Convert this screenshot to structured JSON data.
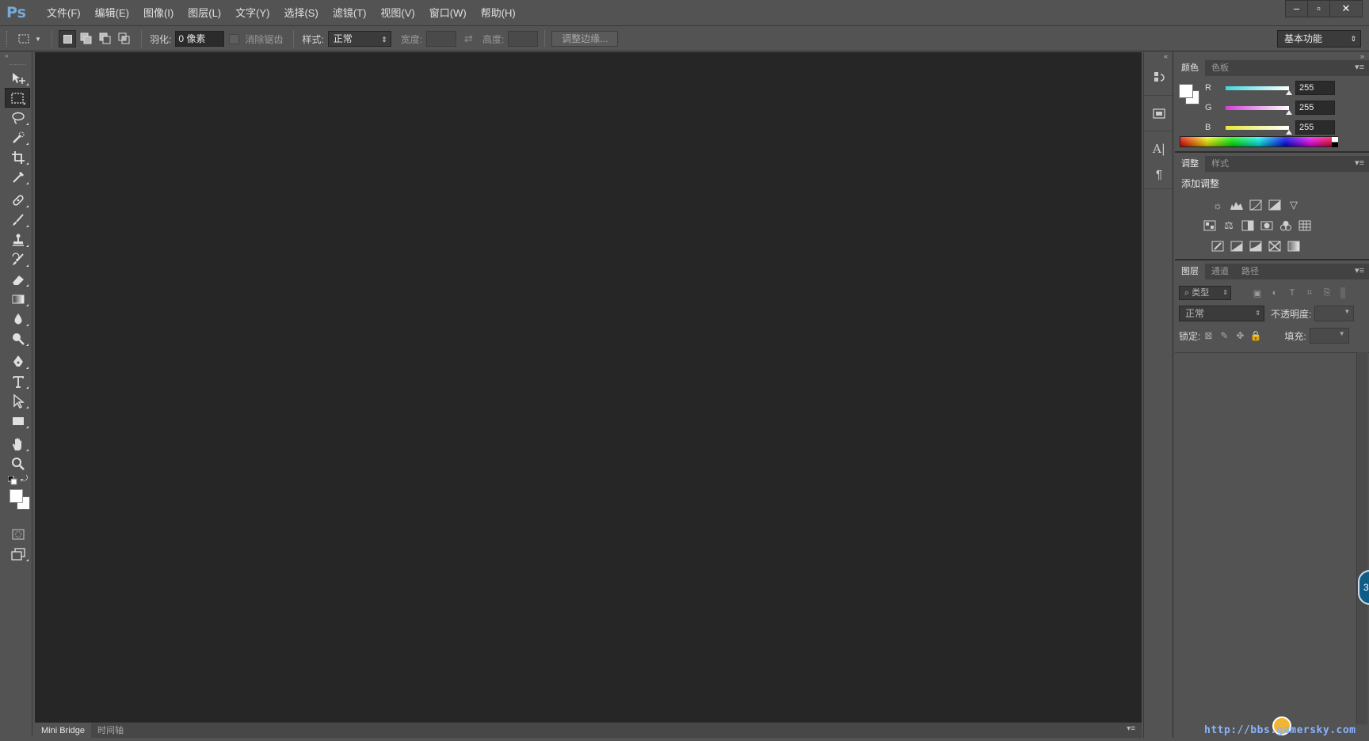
{
  "app": {
    "logo": "Ps"
  },
  "menu": [
    "文件(F)",
    "编辑(E)",
    "图像(I)",
    "图层(L)",
    "文字(Y)",
    "选择(S)",
    "滤镜(T)",
    "视图(V)",
    "窗口(W)",
    "帮助(H)"
  ],
  "window_controls": {
    "minimize": "–",
    "restore": "▫",
    "close": "✕"
  },
  "options": {
    "feather_label": "羽化:",
    "feather_value": "0 像素",
    "antialias_label": "消除锯齿",
    "style_label": "样式:",
    "style_value": "正常",
    "width_label": "宽度:",
    "height_label": "高度:",
    "refine_button": "调整边缘...",
    "workspace": "基本功能"
  },
  "bottom_tabs": [
    "Mini Bridge",
    "时间轴"
  ],
  "panels": {
    "color": {
      "tabs": [
        "颜色",
        "色板"
      ],
      "channels": [
        {
          "label": "R",
          "value": "255",
          "color": "#3fd6e0"
        },
        {
          "label": "G",
          "value": "255",
          "color": "#d43fd6"
        },
        {
          "label": "B",
          "value": "255",
          "color": "#e8e83a"
        }
      ]
    },
    "adjustments": {
      "tabs": [
        "调整",
        "样式"
      ],
      "title": "添加调整"
    },
    "layers": {
      "tabs": [
        "图层",
        "通道",
        "路径"
      ],
      "filter": "类型",
      "blend": "正常",
      "opacity_label": "不透明度:",
      "lock_label": "锁定:",
      "fill_label": "填充:"
    }
  },
  "watermark": "http://bbs.gamersky.com",
  "side_badge": "3"
}
